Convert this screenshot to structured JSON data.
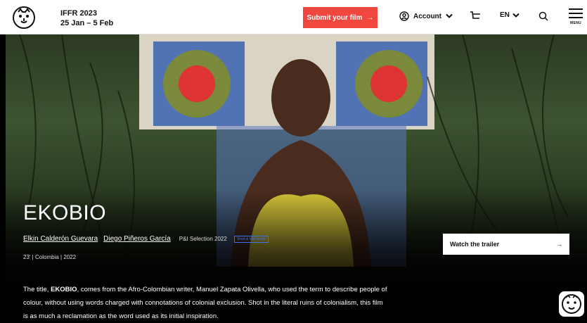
{
  "header": {
    "festival_name": "IFFR 2023",
    "festival_dates": "25 Jan – 5 Feb",
    "submit_label": "Submit your film",
    "submit_arrow": "→",
    "account_label": "Account",
    "language_label": "EN",
    "menu_label": "MENU"
  },
  "film": {
    "title": "EKOBIO",
    "director_1": "Elkin Calderón Guevara",
    "director_2": "Diego Piñeros García",
    "selection": "P&I Selection 2022",
    "tag": "Short & Mid-length",
    "duration": "23'",
    "country": "Colombia",
    "year": "2022",
    "description_prefix": "The title, ",
    "description_title": "EKOBIO",
    "description_rest": ", comes from the Afro-Colombian writer, Manuel Zapata Olivella, who used the term to describe people of colour, without using words charged with connotations of colonial exclusion. Shot in the literal ruins of colonialism, this film is as much a reclamation as the word used as its initial inspiration."
  },
  "trailer": {
    "label": "Watch the trailer",
    "arrow": "→"
  },
  "icons": [
    "iffr-tiger-logo-icon",
    "arrow-right-icon",
    "user-circle-icon",
    "chevron-down-icon",
    "cart-icon",
    "search-icon",
    "hamburger-menu-icon"
  ],
  "colors": {
    "accent": "#f0483e",
    "tag_blue": "#3b74f0"
  }
}
